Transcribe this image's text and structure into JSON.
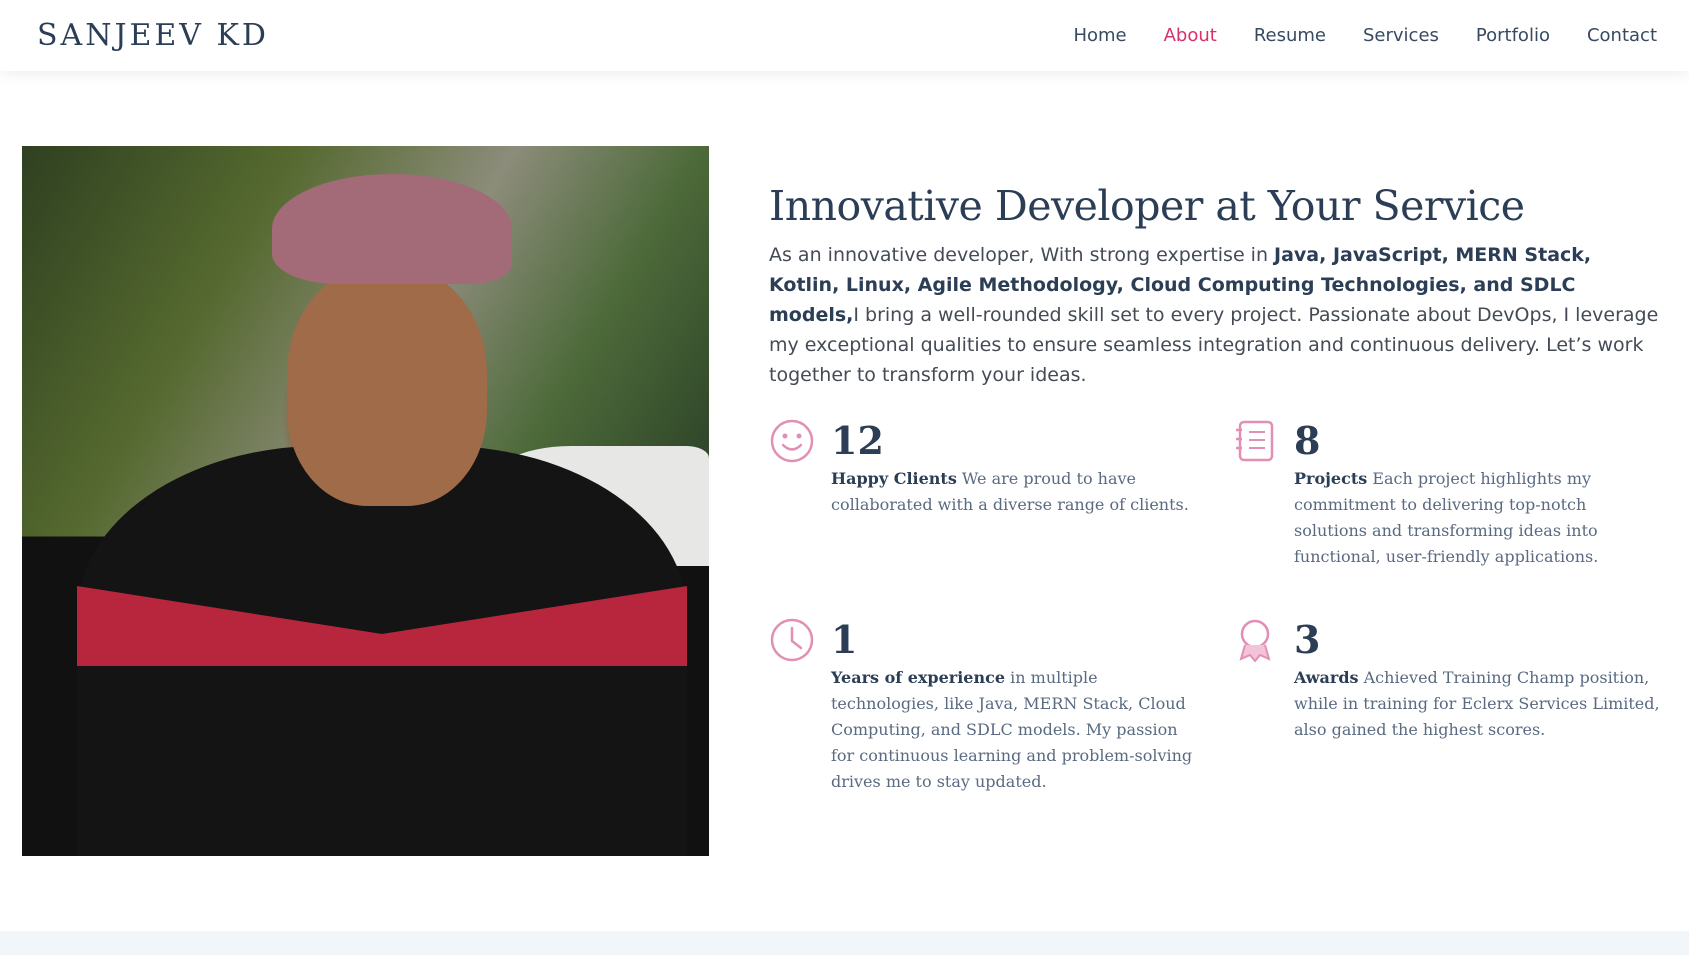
{
  "brand": {
    "name": "SANJEEV KD"
  },
  "nav": {
    "items": [
      {
        "label": "Home",
        "active": false
      },
      {
        "label": "About",
        "active": true
      },
      {
        "label": "Resume",
        "active": false
      },
      {
        "label": "Services",
        "active": false
      },
      {
        "label": "Portfolio",
        "active": false
      },
      {
        "label": "Contact",
        "active": false
      }
    ]
  },
  "about": {
    "heading": "Innovative Developer at Your Service",
    "intro_pre": "As an innovative developer, With strong expertise in ",
    "intro_bold": "Java, JavaScript, MERN Stack, Kotlin, Linux, Agile Methodology, Cloud Computing Technologies, and SDLC models,",
    "intro_post": "I bring a well-rounded skill set to every project. Passionate about DevOps, I leverage my exceptional qualities to ensure seamless integration and continuous delivery. Let’s work together to transform your ideas."
  },
  "stats": [
    {
      "icon": "smiley-icon",
      "number": "12",
      "title": "Happy Clients",
      "text": " We are proud to have collaborated with a diverse range of clients."
    },
    {
      "icon": "journal-icon",
      "number": "8",
      "title": "Projects",
      "text": " Each project highlights my commitment to delivering top-notch solutions and transforming ideas into functional, user-friendly applications."
    },
    {
      "icon": "clock-icon",
      "number": "1",
      "title": "Years of experience",
      "text": " in multiple technologies, like Java, MERN Stack, Cloud Computing, and SDLC models. My passion for continuous learning and problem-solving drives me to stay updated."
    },
    {
      "icon": "award-icon",
      "number": "3",
      "title": "Awards",
      "text": " Achieved Training Champ position, while in training for Eclerx Services Limited, also gained the highest scores."
    }
  ],
  "colors": {
    "accent": "#d8306d",
    "icon": "#e28fb6",
    "heading": "#2b3e56"
  }
}
